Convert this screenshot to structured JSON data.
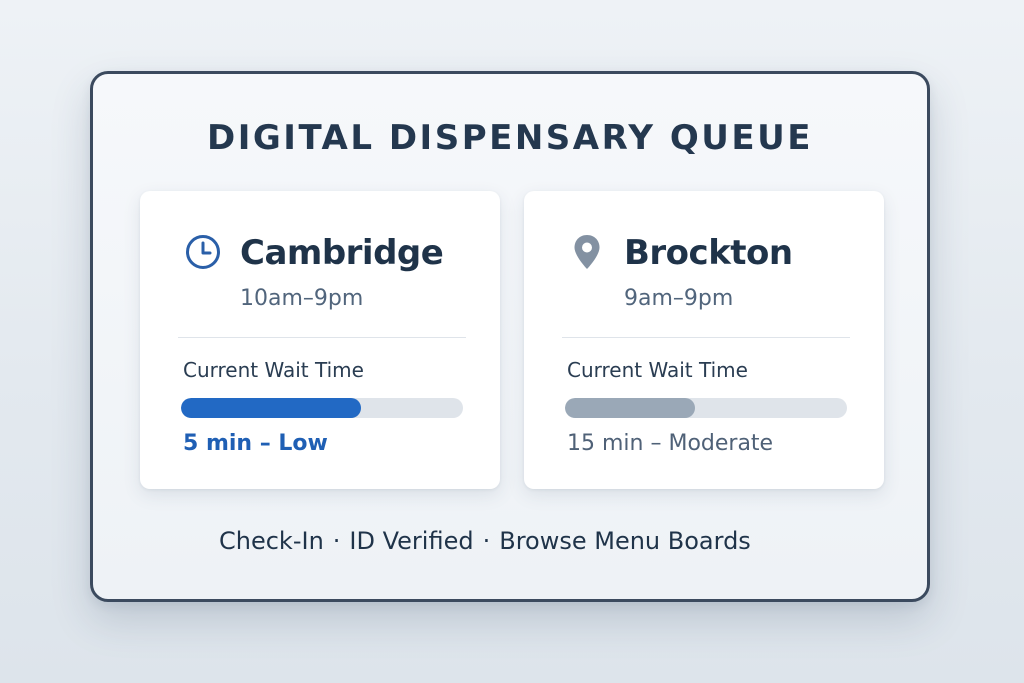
{
  "title": "DIGITAL DISPENSARY QUEUE",
  "locations": [
    {
      "name": "Cambridge",
      "hours": "10am–9pm",
      "icon": "clock-icon",
      "wait_label": "Current Wait Time",
      "wait_status": "5 min – Low",
      "wait_fraction": 0.64,
      "bar_color": "#2269c4",
      "status_color": "#1f5fb4",
      "icon_color": "#2a5fa8"
    },
    {
      "name": "Brockton",
      "hours": "9am–9pm",
      "icon": "location-pin-icon",
      "wait_label": "Current Wait Time",
      "wait_status": "15 min – Moderate",
      "wait_fraction": 0.46,
      "bar_color": "#9aa8b7",
      "status_color": "#4f6177",
      "icon_color": "#8391a2"
    }
  ],
  "footer": {
    "items": [
      "Check-In",
      "ID Verified",
      "Browse Menu Boards"
    ],
    "separator": "·"
  }
}
